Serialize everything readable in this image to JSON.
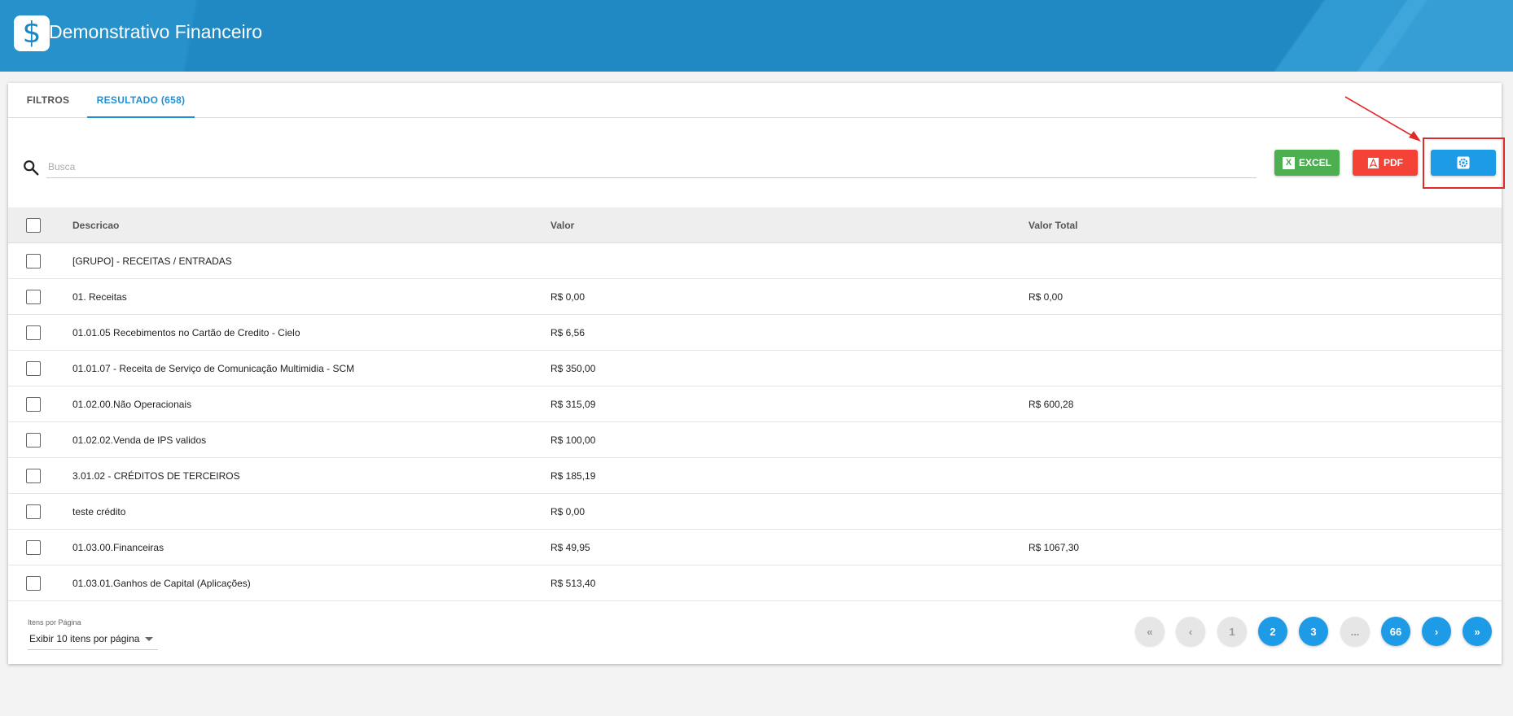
{
  "header": {
    "title": "Demonstrativo Financeiro",
    "logo_symbol": "$"
  },
  "tabs": [
    {
      "label": "FILTROS",
      "active": false
    },
    {
      "label": "RESULTADO (658)",
      "active": true
    }
  ],
  "search": {
    "placeholder": "Busca",
    "value": ""
  },
  "toolbar": {
    "excel_label": "EXCEL",
    "pdf_label": "PDF",
    "settings_icon": "gear-icon",
    "excel_color": "#4caf50",
    "pdf_color": "#f44336",
    "settings_color": "#1e9be6"
  },
  "table": {
    "columns": [
      "Descricao",
      "Valor",
      "Valor Total"
    ],
    "rows": [
      {
        "descricao": "[GRUPO] - RECEITAS / ENTRADAS",
        "valor": "",
        "valor_total": ""
      },
      {
        "descricao": "01. Receitas",
        "valor": "R$ 0,00",
        "valor_total": "R$ 0,00"
      },
      {
        "descricao": "01.01.05 Recebimentos no Cartão de Credito - Cielo",
        "valor": "R$ 6,56",
        "valor_total": ""
      },
      {
        "descricao": "01.01.07 - Receita de Serviço de Comunicação Multimidia - SCM",
        "valor": "R$ 350,00",
        "valor_total": ""
      },
      {
        "descricao": "01.02.00.Não Operacionais",
        "valor": "R$ 315,09",
        "valor_total": "R$ 600,28"
      },
      {
        "descricao": "01.02.02.Venda de IPS validos",
        "valor": "R$ 100,00",
        "valor_total": ""
      },
      {
        "descricao": "3.01.02 - CRÉDITOS DE TERCEIROS",
        "valor": "R$ 185,19",
        "valor_total": ""
      },
      {
        "descricao": "teste crédito",
        "valor": "R$ 0,00",
        "valor_total": ""
      },
      {
        "descricao": "01.03.00.Financeiras",
        "valor": "R$ 49,95",
        "valor_total": "R$ 1067,30"
      },
      {
        "descricao": "01.03.01.Ganhos de Capital (Aplicações)",
        "valor": "R$ 513,40",
        "valor_total": ""
      }
    ]
  },
  "footer": {
    "items_per_page_label": "Itens por Página",
    "items_per_page_value": "Exibir 10 itens por página"
  },
  "pagination": {
    "first": "«",
    "prev": "‹",
    "pages": [
      "1",
      "2",
      "3",
      "...",
      "66"
    ],
    "next": "›",
    "last": "»",
    "current_page": "1"
  }
}
